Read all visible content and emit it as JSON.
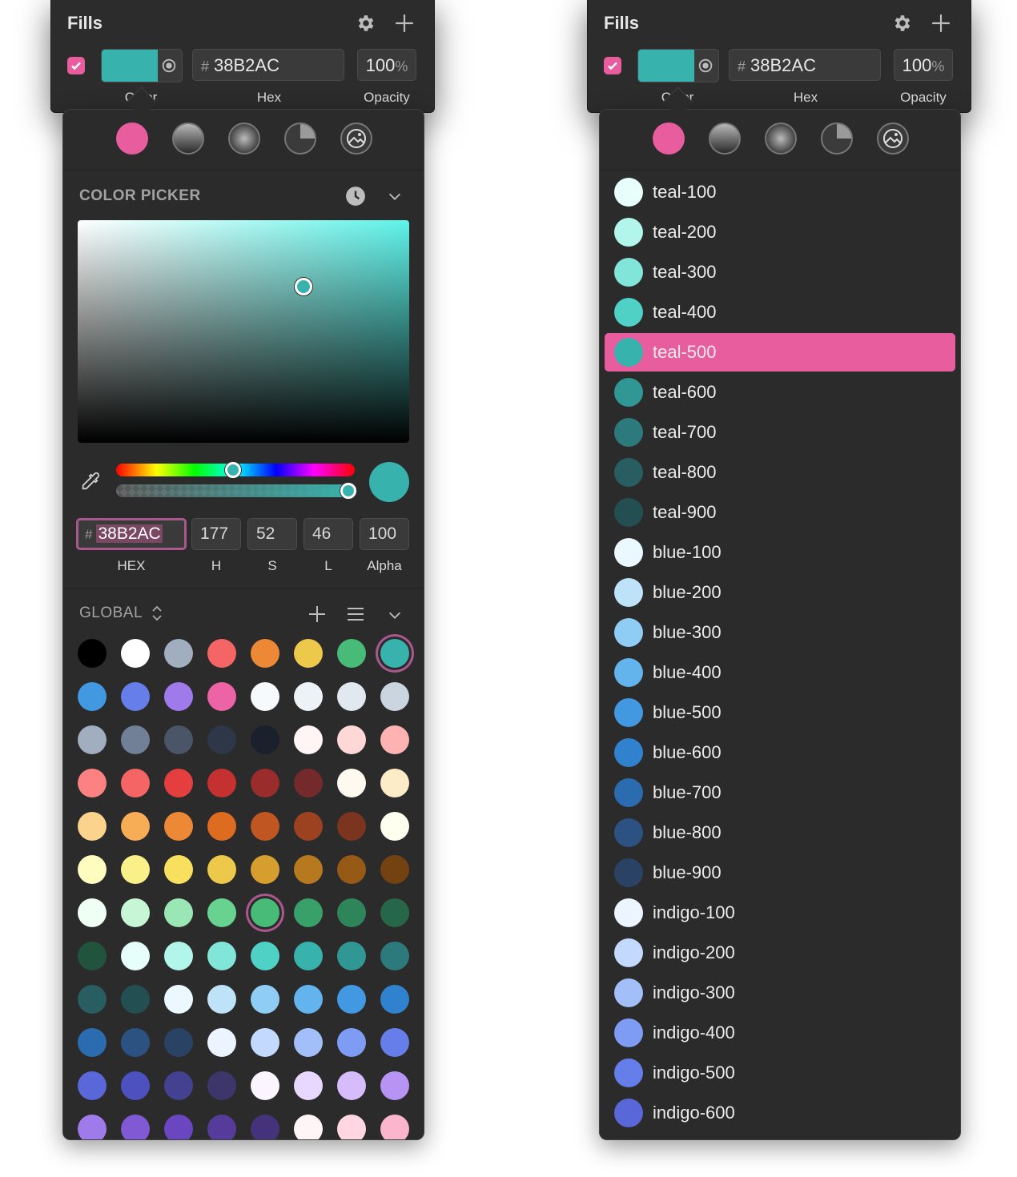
{
  "panels": [
    {
      "inspector": {
        "title": "Fills",
        "hex_prefix": "#",
        "hex_value": "38B2AC",
        "opacity_value": "100",
        "opacity_unit": "%",
        "labels": {
          "color": "Color",
          "hex": "Hex",
          "opacity": "Opacity"
        },
        "swatch_color": "#38B2AC",
        "enabled": true
      },
      "fill_types": [
        "solid",
        "linear-gradient",
        "radial-gradient",
        "angular-gradient",
        "image"
      ],
      "picker": {
        "title": "COLOR PICKER",
        "hex_prefix": "#",
        "hex": "38B2AC",
        "h": "177",
        "s": "52",
        "l": "46",
        "alpha": "100",
        "labels": {
          "hex": "HEX",
          "h": "H",
          "s": "S",
          "l": "L",
          "alpha": "Alpha"
        },
        "hue_fraction": 0.49,
        "alpha_fraction": 1.0,
        "saturation_fraction": 0.68,
        "brightness_fraction": 0.7
      },
      "global": {
        "title": "GLOBAL",
        "selected_index": 52,
        "swatches": [
          "#000000",
          "#ffffff",
          "#a0aec0",
          "#f56565",
          "#ed8936",
          "#ecc94b",
          "#48bb78",
          "#38b2ac",
          "#4299e1",
          "#667eea",
          "#9f7aea",
          "#ed64a6",
          "#f7fafc",
          "#edf2f7",
          "#e2e8f0",
          "#cbd5e0",
          "#a0aec0",
          "#718096",
          "#4a5568",
          "#2d3748",
          "#1a202c",
          "#fff5f5",
          "#fed7d7",
          "#feb2b2",
          "#fc8181",
          "#f56565",
          "#e53e3e",
          "#c53030",
          "#9b2c2c",
          "#742a2a",
          "#fffaf0",
          "#feebc8",
          "#fbd38d",
          "#f6ad55",
          "#ed8936",
          "#dd6b20",
          "#c05621",
          "#9c4221",
          "#7b341e",
          "#fffff0",
          "#fefcbf",
          "#faf089",
          "#f6e05e",
          "#ecc94b",
          "#d69e2e",
          "#b7791f",
          "#975a16",
          "#744210",
          "#f0fff4",
          "#c6f6d5",
          "#9ae6b4",
          "#68d391",
          "#48bb78",
          "#38a169",
          "#2f855a",
          "#276749",
          "#22543d",
          "#e6fffa",
          "#b2f5ea",
          "#81e6d9",
          "#4fd1c5",
          "#38b2ac",
          "#319795",
          "#2c7a7b",
          "#285e61",
          "#234e52",
          "#ebf8ff",
          "#bee3f8",
          "#90cdf4",
          "#63b3ed",
          "#4299e1",
          "#3182ce",
          "#2b6cb0",
          "#2c5282",
          "#2a4365",
          "#ebf4ff",
          "#c3dafe",
          "#a3bffa",
          "#7f9cf5",
          "#667eea",
          "#5a67d8",
          "#4c51bf",
          "#434190",
          "#3c366b",
          "#faf5ff",
          "#e9d8fd",
          "#d6bcfa",
          "#b794f4",
          "#9f7aea",
          "#805ad5",
          "#6b46c1",
          "#553c9a",
          "#44337a",
          "#fff5f7",
          "#fed7e2",
          "#fbb6ce"
        ]
      }
    },
    {
      "inspector": {
        "title": "Fills",
        "hex_prefix": "#",
        "hex_value": "38B2AC",
        "opacity_value": "100",
        "opacity_unit": "%",
        "labels": {
          "color": "Color",
          "hex": "Hex",
          "opacity": "Opacity"
        },
        "swatch_color": "#38B2AC",
        "enabled": true
      },
      "fill_types": [
        "solid",
        "linear-gradient",
        "radial-gradient",
        "angular-gradient",
        "image"
      ],
      "list": {
        "selected_index": 4,
        "items": [
          {
            "name": "teal-100",
            "color": "#e6fffa"
          },
          {
            "name": "teal-200",
            "color": "#b2f5ea"
          },
          {
            "name": "teal-300",
            "color": "#81e6d9"
          },
          {
            "name": "teal-400",
            "color": "#4fd1c5"
          },
          {
            "name": "teal-500",
            "color": "#38b2ac"
          },
          {
            "name": "teal-600",
            "color": "#319795"
          },
          {
            "name": "teal-700",
            "color": "#2c7a7b"
          },
          {
            "name": "teal-800",
            "color": "#285e61"
          },
          {
            "name": "teal-900",
            "color": "#234e52"
          },
          {
            "name": "blue-100",
            "color": "#ebf8ff"
          },
          {
            "name": "blue-200",
            "color": "#bee3f8"
          },
          {
            "name": "blue-300",
            "color": "#90cdf4"
          },
          {
            "name": "blue-400",
            "color": "#63b3ed"
          },
          {
            "name": "blue-500",
            "color": "#4299e1"
          },
          {
            "name": "blue-600",
            "color": "#3182ce"
          },
          {
            "name": "blue-700",
            "color": "#2b6cb0"
          },
          {
            "name": "blue-800",
            "color": "#2c5282"
          },
          {
            "name": "blue-900",
            "color": "#2a4365"
          },
          {
            "name": "indigo-100",
            "color": "#ebf4ff"
          },
          {
            "name": "indigo-200",
            "color": "#c3dafe"
          },
          {
            "name": "indigo-300",
            "color": "#a3bffa"
          },
          {
            "name": "indigo-400",
            "color": "#7f9cf5"
          },
          {
            "name": "indigo-500",
            "color": "#667eea"
          },
          {
            "name": "indigo-600",
            "color": "#5a67d8"
          }
        ]
      }
    }
  ],
  "colors": {
    "accent": "#e85d9e",
    "selection_ring": "#a9578d",
    "panel_bg": "#2c2c2d"
  }
}
